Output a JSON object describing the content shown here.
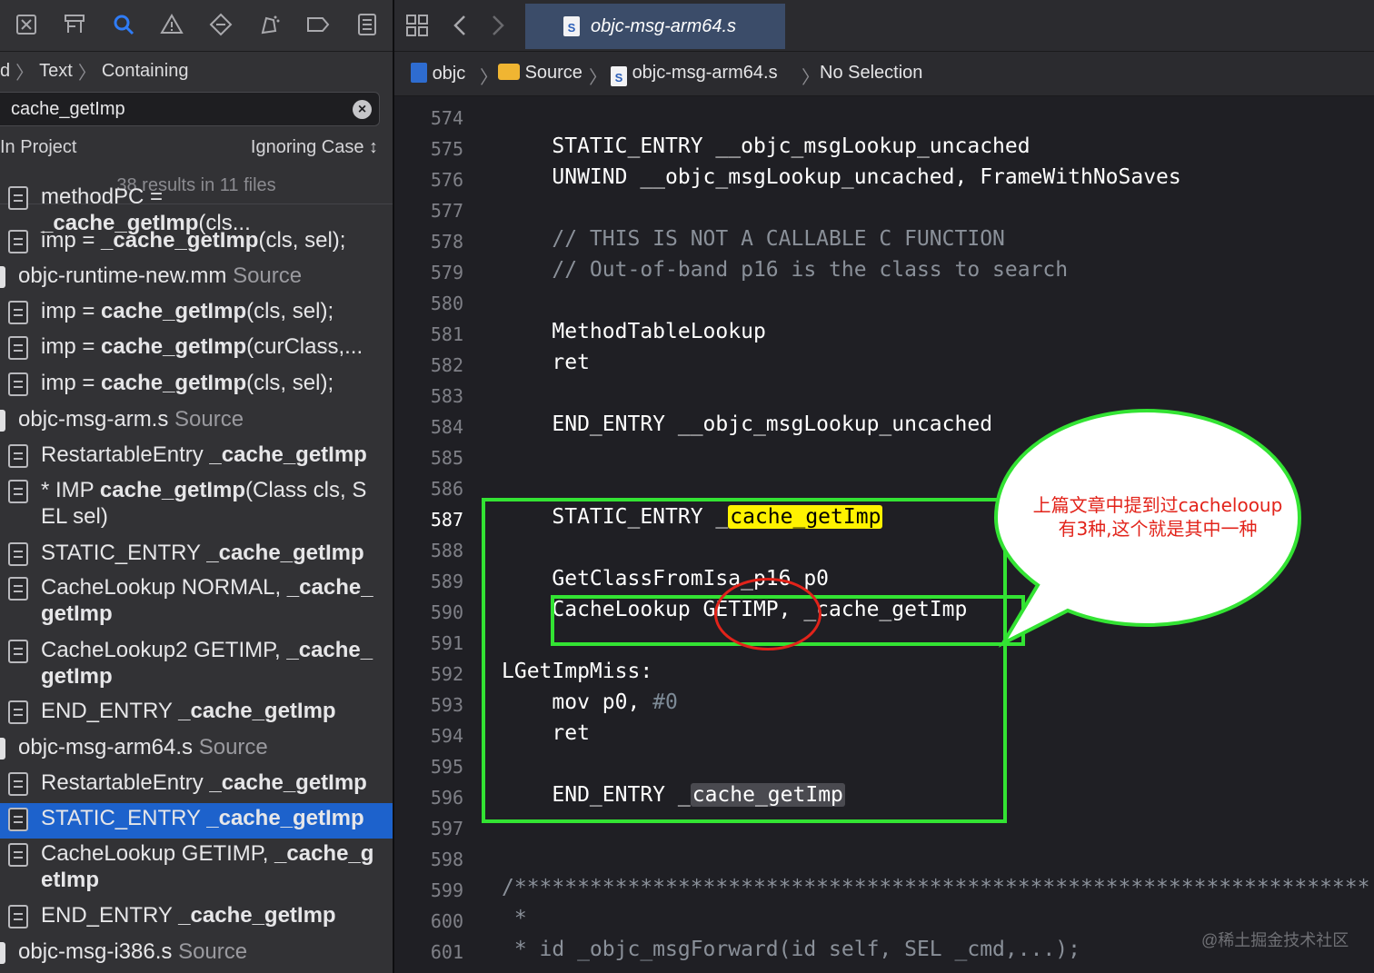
{
  "toolbar": {
    "icons": [
      "project-navigator-icon",
      "hierarchy-icon",
      "find-icon",
      "issues-icon",
      "tests-icon",
      "debug-icon",
      "breakpoint-icon",
      "report-icon"
    ]
  },
  "find": {
    "path": [
      "d",
      "Text",
      "Containing"
    ],
    "query": "cache_getImp",
    "scope": "In Project",
    "case": "Ignoring Case ↕",
    "result_count": "38 results in 11 files"
  },
  "results": [
    {
      "kind": "line",
      "pre": "methodPC = ",
      "match": "_cache_getImp",
      "post": "(cls..."
    },
    {
      "kind": "line",
      "pre": "imp = ",
      "match": "_cache_getImp",
      "post": "(cls, sel);"
    },
    {
      "kind": "file",
      "name": "objc-runtime-new.mm",
      "group": "Source"
    },
    {
      "kind": "line",
      "pre": "imp = ",
      "match": "cache_getImp",
      "post": "(cls, sel);"
    },
    {
      "kind": "line",
      "pre": "imp = ",
      "match": "cache_getImp",
      "post": "(curClass,..."
    },
    {
      "kind": "line",
      "pre": "imp = ",
      "match": "cache_getImp",
      "post": "(cls, sel);"
    },
    {
      "kind": "file",
      "name": "objc-msg-arm.s",
      "group": "Source"
    },
    {
      "kind": "line",
      "pre": "RestartableEntry ",
      "match": "_cache_getImp",
      "post": ""
    },
    {
      "kind": "line2",
      "pre": "* IMP ",
      "match": "cache_getImp",
      "post": "(Class cls, S",
      "line2": "EL sel)"
    },
    {
      "kind": "line",
      "pre": "STATIC_ENTRY ",
      "match": "_cache_getImp",
      "post": ""
    },
    {
      "kind": "line2",
      "pre": "CacheLookup NORMAL, ",
      "match": "_cache_",
      "post": "",
      "line2b": "getImp"
    },
    {
      "kind": "line2",
      "pre": "CacheLookup2 GETIMP, ",
      "match": "_cache_",
      "post": "",
      "line2b": "getImp"
    },
    {
      "kind": "line",
      "pre": "END_ENTRY ",
      "match": "_cache_getImp",
      "post": ""
    },
    {
      "kind": "file",
      "name": "objc-msg-arm64.s",
      "group": "Source"
    },
    {
      "kind": "line",
      "pre": "RestartableEntry ",
      "match": "_cache_getImp",
      "post": ""
    },
    {
      "kind": "line",
      "pre": "STATIC_ENTRY ",
      "match": "_cache_getImp",
      "post": "",
      "selected": true
    },
    {
      "kind": "line2",
      "pre": "CacheLookup GETIMP, ",
      "match": "_cache_g",
      "post": "",
      "line2b": "etImp"
    },
    {
      "kind": "line",
      "pre": "END_ENTRY ",
      "match": "_cache_getImp",
      "post": ""
    },
    {
      "kind": "file",
      "name": "objc-msg-i386.s",
      "group": "Source"
    }
  ],
  "editor": {
    "tab_title": "objc-msg-arm64.s",
    "jumpbar": [
      "objc",
      "Source",
      "objc-msg-arm64.s",
      "No Selection"
    ],
    "current_line": 587,
    "lines": [
      {
        "n": "574",
        "text": ""
      },
      {
        "n": "575",
        "text": "    STATIC_ENTRY __objc_msgLookup_uncached"
      },
      {
        "n": "576",
        "text": "    UNWIND __objc_msgLookup_uncached, FrameWithNoSaves"
      },
      {
        "n": "577",
        "text": ""
      },
      {
        "n": "578",
        "text": "    // THIS IS NOT A CALLABLE C FUNCTION",
        "comment": true
      },
      {
        "n": "579",
        "text": "    // Out-of-band p16 is the class to search",
        "comment": true
      },
      {
        "n": "580",
        "text": ""
      },
      {
        "n": "581",
        "text": "    MethodTableLookup"
      },
      {
        "n": "582",
        "text": "    ret"
      },
      {
        "n": "583",
        "text": ""
      },
      {
        "n": "584",
        "text": "    END_ENTRY __objc_msgLookup_uncached"
      },
      {
        "n": "585",
        "text": ""
      },
      {
        "n": "586",
        "text": ""
      },
      {
        "n": "587",
        "text": "    STATIC_ENTRY _",
        "hl": "cache_getImp",
        "hlType": "yellow"
      },
      {
        "n": "588",
        "text": ""
      },
      {
        "n": "589",
        "text": "    GetClassFromIsa_p16 p0"
      },
      {
        "n": "590",
        "text": "    CacheLookup GETIMP, _cache_getImp"
      },
      {
        "n": "591",
        "text": ""
      },
      {
        "n": "592",
        "text": "LGetImpMiss:"
      },
      {
        "n": "593",
        "text": "    mov p0, ",
        "num": "#0"
      },
      {
        "n": "594",
        "text": "    ret"
      },
      {
        "n": "595",
        "text": ""
      },
      {
        "n": "596",
        "text": "    END_ENTRY _",
        "hl": "cache_getImp",
        "hlType": "gray"
      },
      {
        "n": "597",
        "text": ""
      },
      {
        "n": "598",
        "text": ""
      },
      {
        "n": "599",
        "text": "/********************************************************************",
        "comment": true
      },
      {
        "n": "600",
        "text": " *",
        "comment": true
      },
      {
        "n": "601",
        "text": " * id _objc_msgForward(id self, SEL _cmd,...);",
        "comment": true
      }
    ]
  },
  "annotation": {
    "bubble_line1": "上篇文章中提到过cachelooup",
    "bubble_line2": "有3种,这个就是其中一种",
    "colors": {
      "box": "#33e333",
      "ellipse": "#e2231a",
      "text": "#e2231a"
    }
  },
  "watermark": "@稀土掘金技术社区"
}
